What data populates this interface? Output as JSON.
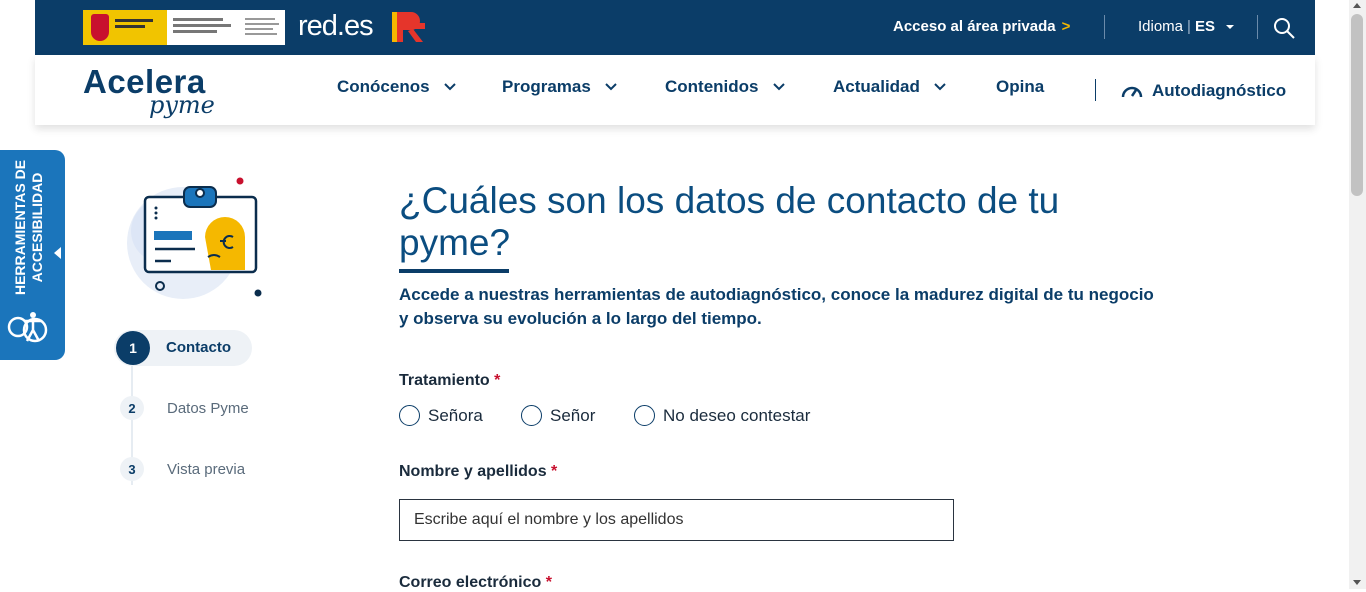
{
  "topbar": {
    "brand": "red.es",
    "private_access": "Acceso al área privada",
    "private_access_chevron": ">",
    "language_label": "Idioma",
    "language_value": "ES",
    "search_icon": "search-icon"
  },
  "nav": {
    "logo_main": "Acelera",
    "logo_sub": "pyme",
    "items": [
      {
        "label": "Conócenos"
      },
      {
        "label": "Programas"
      },
      {
        "label": "Contenidos"
      },
      {
        "label": "Actualidad"
      },
      {
        "label": "Opina"
      }
    ],
    "autodiag": "Autodiagnóstico"
  },
  "accessibility": {
    "line1": "HERRAMIENTAS DE",
    "line2": "ACCESIBILIDAD"
  },
  "steps": [
    {
      "num": "1",
      "label": "Contacto",
      "active": true
    },
    {
      "num": "2",
      "label": "Datos Pyme"
    },
    {
      "num": "3",
      "label": "Vista previa"
    }
  ],
  "main": {
    "title": "¿Cuáles son los datos de contacto de tu pyme?",
    "intro": "Accede a nuestras herramientas de autodiagnóstico, conoce la madurez digital de tu negocio y observa su evolución a lo largo del tiempo.",
    "treatment_label": "Tratamiento",
    "required_mark": "*",
    "treatment_options": [
      "Señora",
      "Señor",
      "No deseo contestar"
    ],
    "name_label": "Nombre y apellidos",
    "name_placeholder": "Escribe aquí el nombre y los apellidos",
    "email_label": "Correo electrónico"
  },
  "colors": {
    "navy": "#0b3d68",
    "accent_yellow": "#f5b800",
    "access_blue": "#1b75bb",
    "required_red": "#c8102e"
  }
}
